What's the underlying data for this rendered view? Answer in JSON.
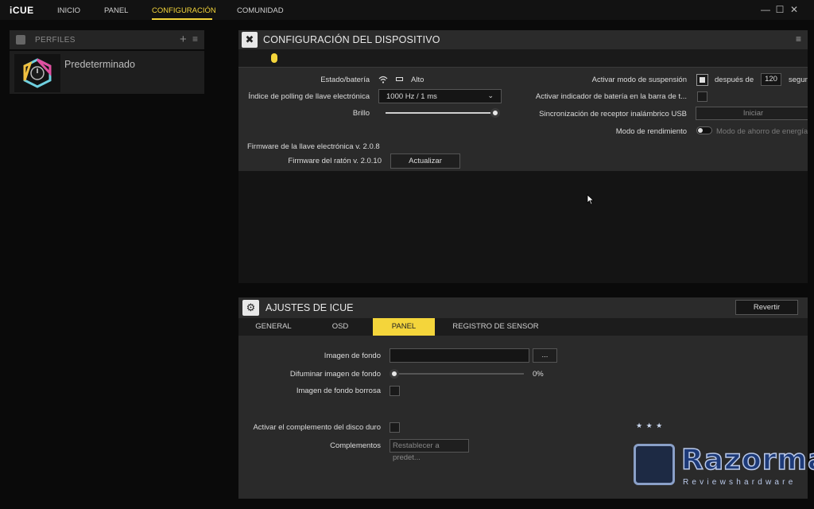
{
  "app": {
    "logo": "iCUE"
  },
  "nav": {
    "items": [
      "INICIO",
      "PANEL",
      "CONFIGURACIÓN",
      "COMUNIDAD"
    ],
    "active": "CONFIGURACIÓN"
  },
  "window": {
    "minimize": "—",
    "maximize": "☐",
    "close": "✕"
  },
  "profiles": {
    "title": "PERFILES",
    "items": [
      {
        "name": "Predeterminado"
      }
    ]
  },
  "device": {
    "title": "CONFIGURACIÓN DEL DISPOSITIVO",
    "status_label": "Estado/batería",
    "status_value": "Alto",
    "polling_label": "Índice de polling de llave electrónica",
    "polling_value": "1000 Hz / 1 ms",
    "brightness_label": "Brillo",
    "brightness_level": 1.0,
    "dongle_fw": "Firmware de la llave electrónica v. 2.0.8",
    "mouse_fw_label": "Firmware del ratón v. 2.0.10",
    "update_button": "Actualizar",
    "sleep_label": "Activar modo de suspensión",
    "sleep_checked": true,
    "after_label": "después de",
    "after_value": "120",
    "seconds_label": "segun",
    "battery_indicator_label": "Activar indicador de batería en la barra de t...",
    "battery_indicator_checked": false,
    "usb_sync_label": "Sincronización de receptor inalámbrico USB",
    "usb_sync_button": "Iniciar",
    "performance_label": "Modo de rendimiento",
    "performance_value": "Modo de ahorro de energía"
  },
  "icue_settings": {
    "title": "AJUSTES DE ICUE",
    "revert_button": "Revertir",
    "tabs": [
      "GENERAL",
      "OSD",
      "PANEL",
      "REGISTRO DE SENSOR"
    ],
    "active_tab": "PANEL",
    "bg_image_label": "Imagen de fondo",
    "browse_button": "...",
    "blur_label": "Difuminar imagen de fondo",
    "blur_value": "0%",
    "blurry_label": "Imagen de fondo borrosa",
    "hdd_label": "Activar el complemento del disco duro",
    "plugins_label": "Complementos",
    "plugins_button": "Restablecer a predet..."
  },
  "watermark": {
    "stars": "★ ★ ★",
    "name": "Razorman",
    "sub": "Reviewshardware"
  },
  "colors": {
    "accent": "#f4d53b",
    "panel": "#2a2a2a",
    "background": "#0a0a0a"
  }
}
